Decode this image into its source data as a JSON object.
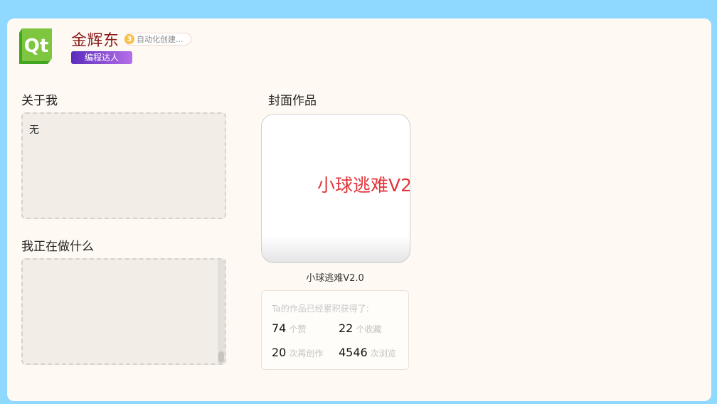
{
  "profile": {
    "username": "金辉东",
    "level": "3",
    "auto_label": "自动化创建...",
    "rank": "编程达人",
    "logo_text": "Qt"
  },
  "sections": {
    "about_title": "关于我",
    "about_text": "无",
    "doing_title": "我正在做什么",
    "doing_text": "",
    "cover_title": "封面作品"
  },
  "cover": {
    "image_text": "小球逃难V2",
    "caption": "小球逃难V2.0"
  },
  "stats": {
    "title": "Ta的作品已经累积获得了:",
    "items": [
      {
        "value": "74",
        "unit": "个赞"
      },
      {
        "value": "22",
        "unit": "个收藏"
      },
      {
        "value": "20",
        "unit": "次再创作"
      },
      {
        "value": "4546",
        "unit": "次浏览"
      }
    ]
  },
  "colors": {
    "background": "#8fd8ff",
    "card": "#fef9f2",
    "username": "#8b1c1c",
    "cover_text": "#e0363b",
    "badge_start": "#5b2dbd",
    "badge_end": "#b56fe8"
  }
}
